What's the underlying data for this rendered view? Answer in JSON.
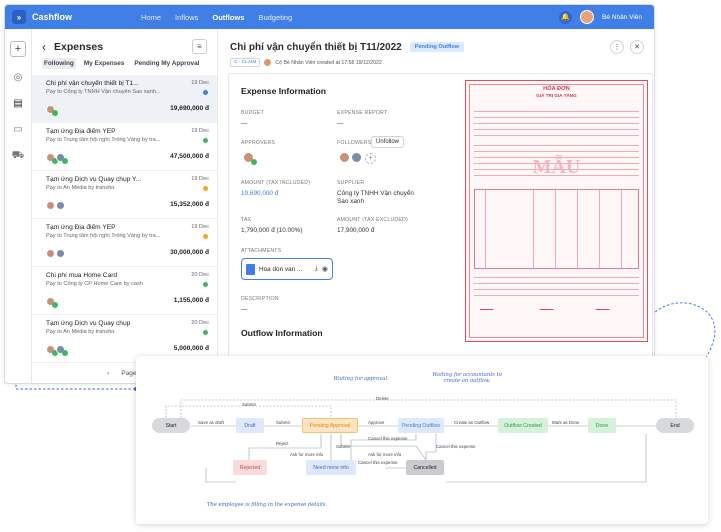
{
  "app": {
    "logo_mark": "»",
    "name": "Cashflow",
    "nav": [
      "Home",
      "Inflows",
      "Outflows",
      "Budgeting"
    ],
    "active_nav": "Outflows",
    "user_name": "Bé Nhân Viên"
  },
  "sidebar_icons": [
    "plus-icon",
    "coin-icon",
    "receipt-icon",
    "folder-icon",
    "truck-icon"
  ],
  "list": {
    "title": "Expenses",
    "tabs": [
      "Following",
      "My Expenses",
      "Pending My Approval"
    ],
    "items": [
      {
        "title": "Chi phí vận chuyển thiết bị T1...",
        "payee": "Pay to Công ty TNHH Vận chuyển Sao xanh...",
        "date": "19 Dec",
        "amount": "19,690,000 đ",
        "status_color": "#3f7fe6"
      },
      {
        "title": "Tạm ứng Địa điểm YEP",
        "payee": "Pay to Trung tâm hội nghị Trống Vàng by tra...",
        "date": "19 Dec",
        "amount": "47,500,000 đ",
        "status_color": "#3db85a"
      },
      {
        "title": "Tạm ứng Dịch vụ Quay chụp Y...",
        "payee": "Pay to An Media by transfer",
        "date": "19 Dec",
        "amount": "15,352,000 đ",
        "status_color": "#f5a623"
      },
      {
        "title": "Tạm ứng Địa điểm YEP",
        "payee": "Pay to Trung tâm hội nghị Trống Vàng by tra...",
        "date": "19 Dec",
        "amount": "30,000,000 đ",
        "status_color": "#f5a623"
      },
      {
        "title": "Chi phí mua Home Card",
        "payee": "Pay to Công ty CP Home Care by cash",
        "date": "20 Dec",
        "amount": "1,155,000 đ",
        "status_color": "#3db85a"
      },
      {
        "title": "Tạm ứng Dịch vụ Quay chụp",
        "payee": "Pay to An Media by transfer",
        "date": "20 Dec",
        "amount": "5,000,000 đ",
        "status_color": "#3db85a"
      }
    ],
    "pager": {
      "prev": "‹",
      "label": "Page 1"
    }
  },
  "detail": {
    "title": "Chi phí vận chuyển thiết bị T11/2022",
    "status": "Pending Outflow",
    "code": "C - CLAIM",
    "meta": "Cộ Bé Nhân Viên created at 17:58 19/12/2022",
    "section_info": "Expense Information",
    "labels": {
      "budget": "BUDGET",
      "report": "EXPENSE REPORT",
      "approvers": "APPROVERS",
      "followers": "FOLLOWERS",
      "amount_incl": "AMOUNT (TAX INCLUDED)",
      "supplier": "SUPPLIER",
      "tax": "TAX",
      "amount_excl": "AMOUNT (TAX EXCLUDED)",
      "attachments": "ATTACHMENTS",
      "description": "DESCRIPTION"
    },
    "values": {
      "budget": "—",
      "report": "—",
      "amount_incl": "19,690,000 đ",
      "supplier": "Công ty TNHH Vận chuyển Sao xanh",
      "tax": "1,790,000 đ (10.00%)",
      "amount_excl": "17,900,000 đ",
      "description": "—"
    },
    "follow_button": "Unfollow",
    "attachment_name": "Hoa don van ...",
    "section_outflow": "Outflow Information",
    "invoice": {
      "title": "HÓA ĐƠN",
      "subtitle": "GIÁ TRỊ GIA TĂNG",
      "watermark": "MẪU"
    }
  },
  "workflow": {
    "nodes": {
      "start": "Start",
      "draft": "Draft",
      "pending_approval": "Pending Approval",
      "pending_outflow": "Pending Outflow",
      "outflow_created": "Outflow Created",
      "done": "Done",
      "end": "End",
      "rejected": "Rejected",
      "need_more_info": "Need more info",
      "cancelled": "Cancelled"
    },
    "edges": {
      "submit_top": "Submit",
      "delete": "Delete",
      "save_as_draft": "Save as draft",
      "submit": "Submit",
      "approve": "Approve",
      "create_outflow": "Create as Outflow",
      "mark_done": "Mark as Done",
      "reject": "Reject",
      "ask_more": "Ask for more info",
      "submit2": "Submit",
      "cancel1": "Cancel this expense",
      "ask_more2": "Ask for more info",
      "cancel2": "Cancel this expense",
      "cancel3": "Cancel this expense"
    },
    "annotations": {
      "approval": "Waiting for approval.",
      "accountants": "Waiting for accountants to create an outflow.",
      "employee": "The employee is filling in the expense details."
    }
  }
}
